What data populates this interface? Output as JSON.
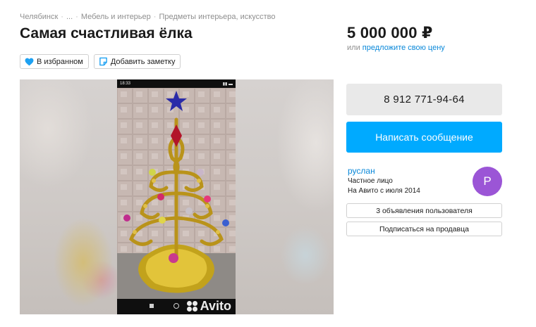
{
  "breadcrumbs": [
    "Челябинск",
    "...",
    "Мебель и интерьер",
    "Предметы интерьера, искусство"
  ],
  "listing": {
    "title": "Самая счастливая ёлка",
    "favorite_label": "В избранном",
    "note_label": "Добавить заметку"
  },
  "price": {
    "value": "5 000 000 ₽",
    "prefix": "или",
    "offer_link": "предложите свою цену"
  },
  "gallery": {
    "status_time": "18:33",
    "watermark": "Avito"
  },
  "contact": {
    "phone": "8 912 771-94-64",
    "message_button": "Написать сообщение"
  },
  "seller": {
    "name": "руслан",
    "type": "Частное лицо",
    "since": "На Авито с июля 2014",
    "avatar_letter": "P",
    "avatar_color": "#9b55d6",
    "ads_button": "3 объявления пользователя",
    "subscribe_button": "Подписаться на продавца"
  },
  "colors": {
    "accent": "#00aaff",
    "link": "#0a88d9"
  }
}
